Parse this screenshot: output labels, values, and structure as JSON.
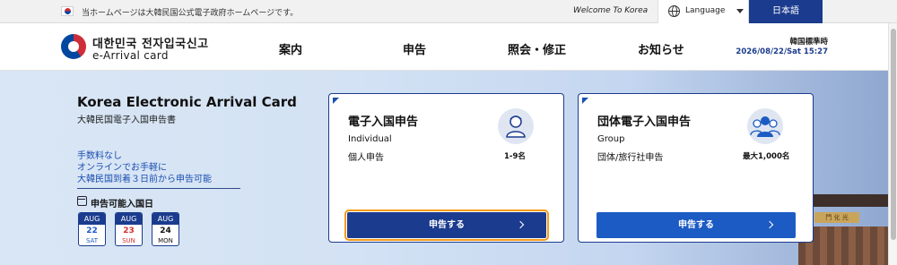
{
  "topbar": {
    "notice": "当ホームページは大韓民国公式電子政府ホームページです。",
    "welcome": "Welcome To Korea",
    "language_label": "Language",
    "japanese_button": "日本語"
  },
  "header": {
    "logo_korean": "대한민국 전자입국신고",
    "logo_english": "e-Arrival card",
    "nav": [
      "案内",
      "申告",
      "照会・修正",
      "お知らせ"
    ],
    "clock_label": "韓国標準時",
    "clock_time": "2026/08/22/Sat 15:27"
  },
  "hero": {
    "title": "Korea Electronic Arrival Card",
    "subtitle": "大韓民国電子入国申告書",
    "features": [
      "手数料なし",
      "オンラインでお手軽に",
      "大韓民国到着３日前から申告可能"
    ],
    "date_label": "申告可能入国日",
    "dates": [
      {
        "month": "AUG",
        "day": "22",
        "weekday": "SAT",
        "color": "#1c5bc3"
      },
      {
        "month": "AUG",
        "day": "23",
        "weekday": "SUN",
        "color": "#d32f2f"
      },
      {
        "month": "AUG",
        "day": "24",
        "weekday": "MON",
        "color": "#111111"
      }
    ],
    "palace_sign": "門 化 光"
  },
  "cards": [
    {
      "title": "電子入国申告",
      "english": "Individual",
      "japanese": "個人申告",
      "capacity": "1-9名",
      "button": "申告する"
    },
    {
      "title": "団体電子入国申告",
      "english": "Group",
      "japanese": "団体/旅行社申告",
      "capacity": "最大1,000名",
      "button": "申告する"
    }
  ],
  "colors": {
    "brand_navy": "#1b3c8e",
    "accent_blue": "#1c5bc3",
    "focus_orange": "#f39a1a"
  }
}
